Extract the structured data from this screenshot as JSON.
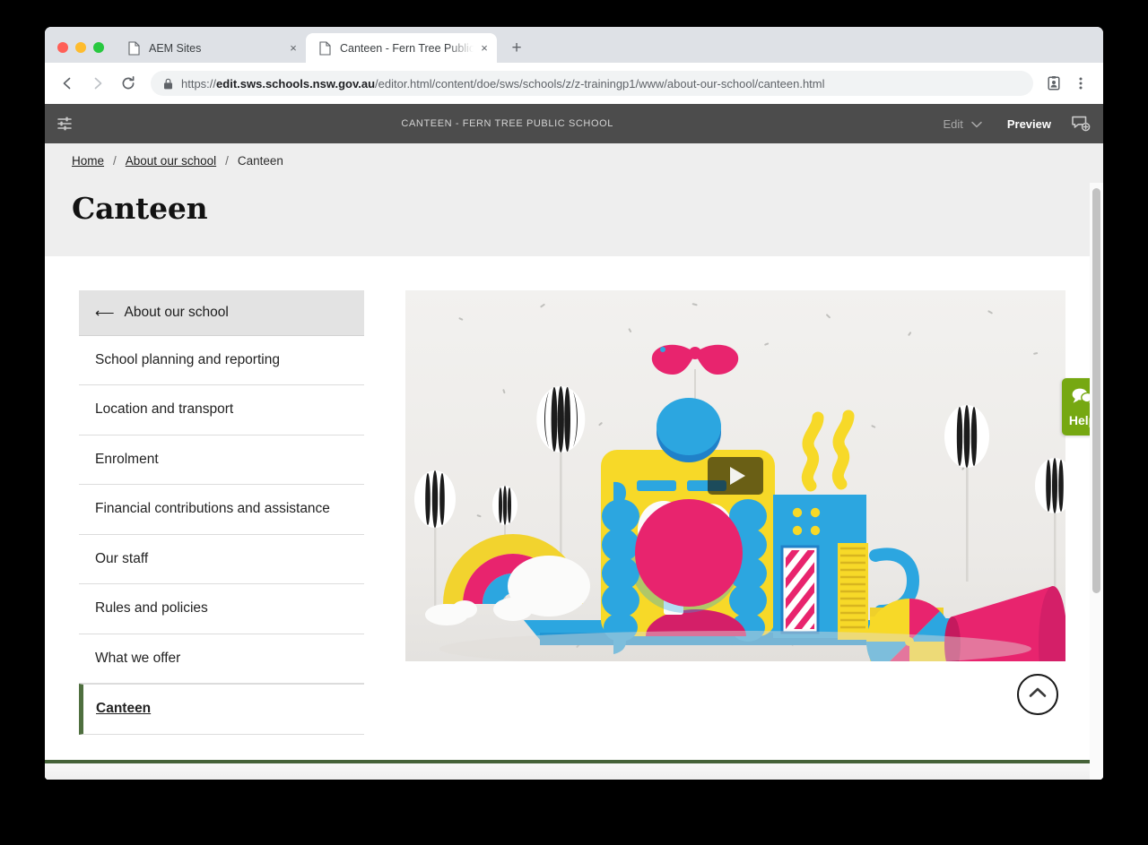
{
  "browser": {
    "tabs": [
      {
        "title": "AEM Sites",
        "active": false,
        "favicon": "page-icon"
      },
      {
        "title": "Canteen - Fern Tree Public School",
        "active": true,
        "favicon": "page-icon"
      }
    ],
    "new_tab_label": "+",
    "close_label": "×",
    "nav": {
      "back_label": "back-arrow-icon",
      "forward_label": "forward-arrow-icon",
      "reload_label": "reload-icon"
    },
    "url": {
      "scheme": "https://",
      "host": "edit.sws.schools.nsw.gov.au",
      "path": "/editor.html/content/doe/sws/schools/z/z-trainingp1/www/about-our-school/canteen.html",
      "full": "https://edit.sws.schools.nsw.gov.au/editor.html/content/doe/sws/schools/z/z-trainingp1/www/about-our-school/canteen.html",
      "secure": true
    },
    "toolbar_icons": [
      "profile-card-icon",
      "more-menu-icon"
    ]
  },
  "aem": {
    "rail_toggle": "side-panel-toggle-icon",
    "page_title": "CANTEEN - FERN TREE PUBLIC SCHOOL",
    "edit_mode_label": "Edit",
    "preview_label": "Preview",
    "annotate_icon": "annotate-icon",
    "bar_color": "#4c4c4c"
  },
  "site": {
    "breadcrumb": [
      {
        "label": "Home",
        "link": true
      },
      {
        "label": "About our school",
        "link": true
      },
      {
        "label": "Canteen",
        "link": false
      }
    ],
    "breadcrumb_separator": "/",
    "page_heading": "Canteen",
    "sidebar": {
      "parent": {
        "label": "About our school",
        "icon": "back-arrow-icon"
      },
      "items": [
        {
          "label": "School planning and reporting",
          "active": false
        },
        {
          "label": "Location and transport",
          "active": false
        },
        {
          "label": "Enrolment",
          "active": false
        },
        {
          "label": "Financial contributions and assistance",
          "active": false
        },
        {
          "label": "Our staff",
          "active": false
        },
        {
          "label": "Rules and policies",
          "active": false
        },
        {
          "label": "What we offer",
          "active": false
        },
        {
          "label": "Canteen",
          "active": true
        }
      ],
      "active_accent_color": "#4f6f3f"
    },
    "video": {
      "play_button_icon": "play-triangle-icon",
      "poster_description": "Colourful papercraft machine character with yellow body, blue arms, pink nose, balloons, rainbow and megaphone"
    },
    "back_to_top": {
      "icon": "chevron-up-icon"
    },
    "help_widget": {
      "label": "Help",
      "icon": "chat-bubbles-icon",
      "color": "#76a812"
    },
    "footer_rule_color": "#446137"
  }
}
